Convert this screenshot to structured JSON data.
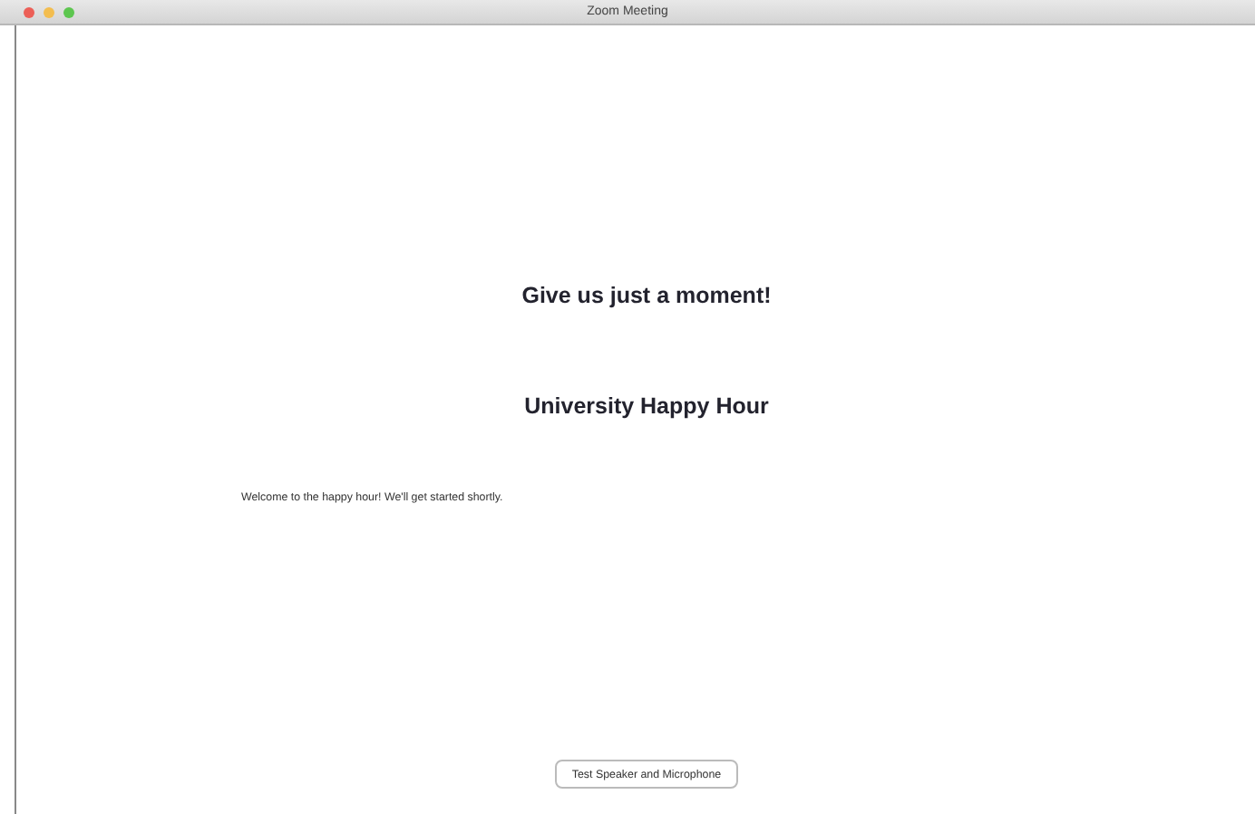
{
  "window": {
    "title": "Zoom Meeting"
  },
  "heading": "Give us just a moment!",
  "meeting_name": "University Happy Hour",
  "message": "Welcome to the happy hour! We'll get started shortly.",
  "button": "Test Speaker and Microphone"
}
